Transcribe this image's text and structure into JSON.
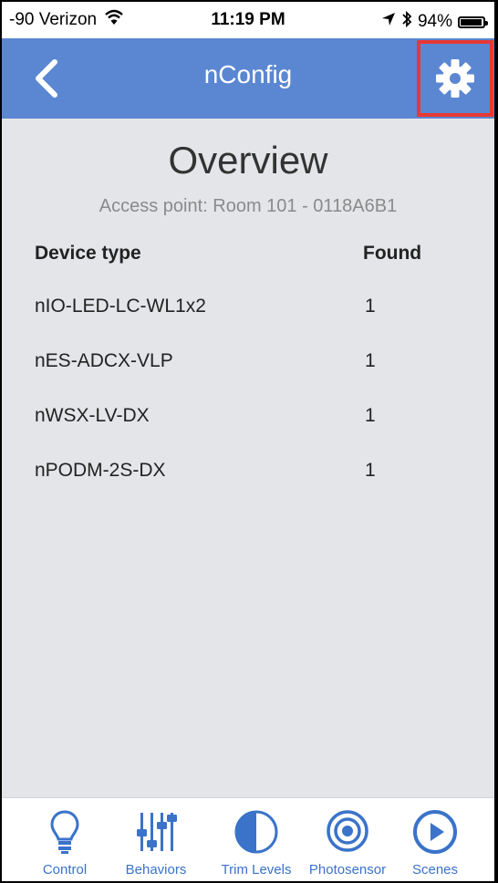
{
  "status_bar": {
    "carrier": "-90 Verizon",
    "time": "11:19 PM",
    "battery": "94%",
    "battery_level": 0.94
  },
  "nav": {
    "title": "nConfig",
    "back_icon": "chevron-left-icon",
    "settings_icon": "gear-icon",
    "highlight_color": "#e53935"
  },
  "overview": {
    "title": "Overview",
    "access_point": "Access point: Room 101 - 0118A6B1"
  },
  "table": {
    "headers": [
      "Device type",
      "Found"
    ],
    "rows": [
      {
        "device": "nIO-LED-LC-WL1x2",
        "found": "1"
      },
      {
        "device": "nES-ADCX-VLP",
        "found": "1"
      },
      {
        "device": "nWSX-LV-DX",
        "found": "1"
      },
      {
        "device": "nPODM-2S-DX",
        "found": "1"
      }
    ]
  },
  "tabs": [
    {
      "label": "Control",
      "icon": "lightbulb-icon"
    },
    {
      "label": "Behaviors",
      "icon": "sliders-icon"
    },
    {
      "label": "Trim Levels",
      "icon": "half-circle-icon"
    },
    {
      "label": "Photosensor",
      "icon": "concentric-circles-icon"
    },
    {
      "label": "Scenes",
      "icon": "play-circle-icon"
    }
  ],
  "colors": {
    "nav_bg": "#5b87d2",
    "accent": "#3a73c9",
    "content_bg": "#e4e5e9"
  }
}
